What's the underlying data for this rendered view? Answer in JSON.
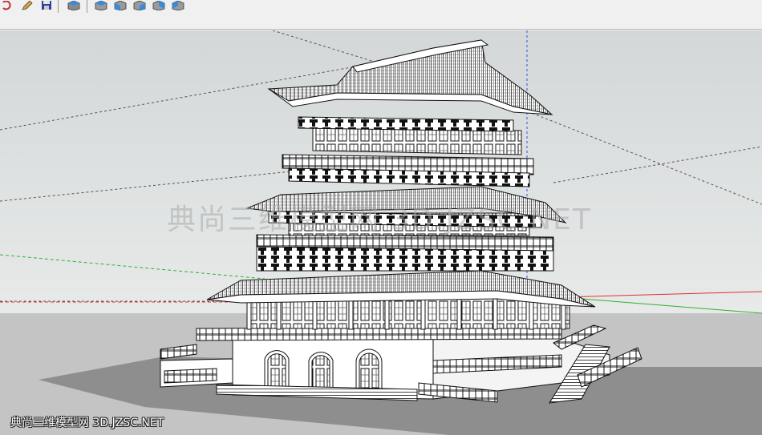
{
  "toolbar": {
    "buttons": [
      {
        "id": "undo",
        "icon": "undo-icon"
      },
      {
        "id": "edit",
        "icon": "pencil-icon"
      },
      {
        "id": "save",
        "icon": "save-icon"
      },
      {
        "id": "view-iso",
        "icon": "view-iso-icon"
      },
      {
        "id": "view-top",
        "icon": "view-top-icon"
      },
      {
        "id": "view-front",
        "icon": "view-front-icon"
      },
      {
        "id": "view-right",
        "icon": "view-right-icon"
      },
      {
        "id": "view-back",
        "icon": "view-back-icon"
      },
      {
        "id": "view-left",
        "icon": "view-left-icon"
      }
    ]
  },
  "viewport": {
    "watermark_center": "典尚三维模型网 3D.JZSC.NET",
    "watermark_corner": "典尚三维模型网 3D.JZSC.NET",
    "sky_color": "#d9dcdc",
    "ground_color": "#c4c4c4",
    "axis_colors": {
      "red": "#e03030",
      "green": "#30b030",
      "blue": "#3050e0"
    }
  }
}
